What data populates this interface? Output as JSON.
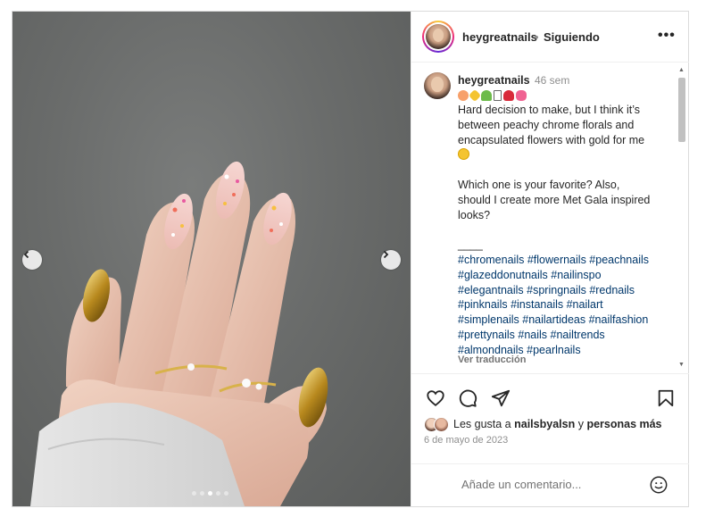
{
  "header": {
    "username": "heygreatnails",
    "separator": "•",
    "follow_status": "Siguiendo",
    "more_icon": "more-options-icon"
  },
  "media": {
    "slide_count": 5,
    "active_slide": 3,
    "prev_icon": "chevron-left-icon",
    "next_icon": "chevron-right-icon"
  },
  "caption": {
    "username": "heygreatnails",
    "time": "46 sem",
    "emojis": [
      "peach",
      "sparkles",
      "flower",
      "lock",
      "rose",
      "bow"
    ],
    "lines": [
      "Hard decision to make, but I think it’s",
      "between peachy chrome florals and",
      "encapsulated flowers with gold for me"
    ],
    "question_lines": [
      "Which one is your favorite? Also,",
      "should I create more Met Gala inspired",
      "looks?"
    ],
    "divider": "____",
    "hashtag_lines": [
      "#chromenails #flowernails #peachnails",
      "#glazeddonutnails #nailinspo",
      "#elegantnails #springnails #rednails",
      "#pinknails #instanails #nailart",
      "#simplenails #nailartideas #nailfashion",
      "#prettynails #nails #nailtrends",
      "#almondnails #pearlnails"
    ],
    "translate_label": "Ver traducción"
  },
  "actions": {
    "like_icon": "heart-icon",
    "comment_icon": "comment-icon",
    "share_icon": "share-icon",
    "save_icon": "bookmark-icon"
  },
  "likes": {
    "prefix": "Les gusta a",
    "user": "nailsbyalsn",
    "conjunction": "y",
    "others": "personas más"
  },
  "date": "6 de mayo de 2023",
  "comment": {
    "placeholder": "Añade un comentario...",
    "emoji_icon": "smiley-icon"
  },
  "colors": {
    "link": "#00376b",
    "muted": "#8e8e8e",
    "text": "#262626",
    "border": "#dbdbdb"
  }
}
